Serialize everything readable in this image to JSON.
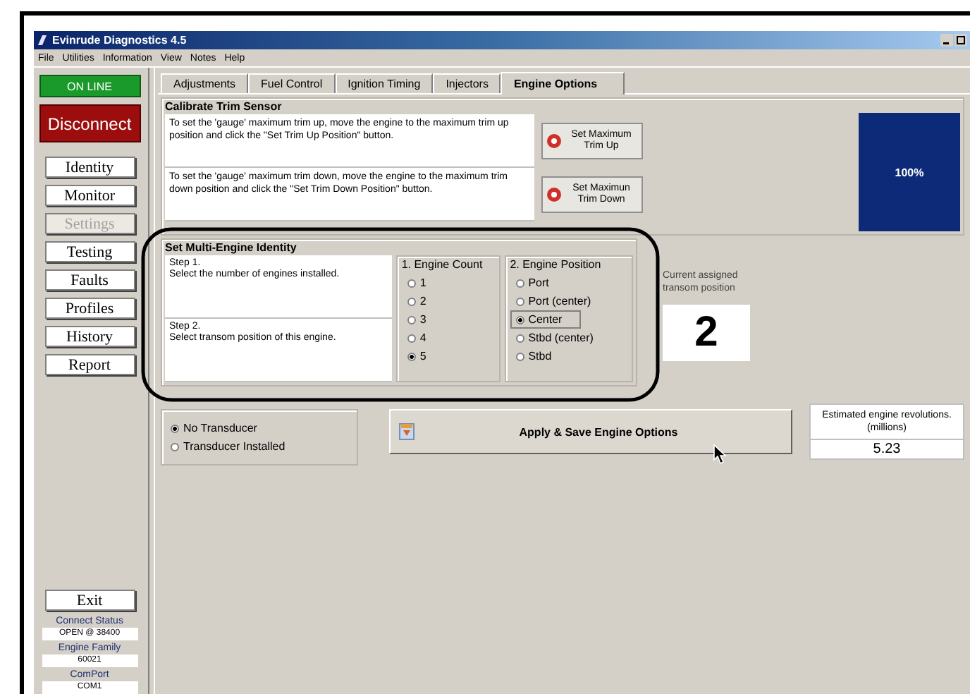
{
  "window": {
    "title": "Evinrude Diagnostics 4.5"
  },
  "menu": [
    "File",
    "Utilities",
    "Information",
    "View",
    "Notes",
    "Help"
  ],
  "sidebar": {
    "status": "ON LINE",
    "disconnect": "Disconnect",
    "items": [
      {
        "label": "Identity",
        "disabled": false
      },
      {
        "label": "Monitor",
        "disabled": false
      },
      {
        "label": "Settings",
        "disabled": true
      },
      {
        "label": "Testing",
        "disabled": false
      },
      {
        "label": "Faults",
        "disabled": false
      },
      {
        "label": "Profiles",
        "disabled": false
      },
      {
        "label": "History",
        "disabled": false
      },
      {
        "label": "Report",
        "disabled": false
      }
    ],
    "exit": "Exit",
    "info": [
      {
        "label": "Connect Status",
        "value": "OPEN @ 38400"
      },
      {
        "label": "Engine Family",
        "value": "60021"
      },
      {
        "label": "ComPort",
        "value": "COM1"
      }
    ]
  },
  "tabs": [
    {
      "label": "Adjustments",
      "selected": false
    },
    {
      "label": "Fuel Control",
      "selected": false
    },
    {
      "label": "Ignition Timing",
      "selected": false
    },
    {
      "label": "Injectors",
      "selected": false
    },
    {
      "label": "Engine Options",
      "selected": true
    }
  ],
  "trim": {
    "title": "Calibrate Trim Sensor",
    "rows": [
      {
        "text": "To set the 'gauge' maximum trim up, move the engine to the maximum trim up position and click the \"Set Trim Up Position\" button.",
        "button": "Set Maximum\nTrim Up"
      },
      {
        "text": "To set the 'gauge' maximum trim down, move the engine to the maximum trim down position and click the \"Set Trim Down Position\" button.",
        "button": "Set Maximun\nTrim Down"
      }
    ],
    "gauge": {
      "level": 1,
      "reading": "100%"
    }
  },
  "identity": {
    "title": "Set Multi-Engine Identity",
    "steps": [
      "Step 1.\nSelect the number of engines installed.",
      "Step 2.\nSelect transom position of this engine."
    ],
    "count": {
      "title": "1. Engine Count",
      "options": [
        {
          "label": "1",
          "selected": false
        },
        {
          "label": "2",
          "selected": false
        },
        {
          "label": "3",
          "selected": false
        },
        {
          "label": "4",
          "selected": false
        },
        {
          "label": "5",
          "selected": true
        }
      ]
    },
    "position": {
      "title": "2. Engine Position",
      "options": [
        {
          "label": "Port",
          "selected": false,
          "focused": false
        },
        {
          "label": "Port (center)",
          "selected": false,
          "focused": false
        },
        {
          "label": "Center",
          "selected": true,
          "focused": true
        },
        {
          "label": "Stbd (center)",
          "selected": false,
          "focused": false
        },
        {
          "label": "Stbd",
          "selected": false,
          "focused": false
        }
      ]
    },
    "current": {
      "label": "Current assigned transom position",
      "value": "2"
    }
  },
  "transducer": {
    "options": [
      {
        "label": "No Transducer",
        "selected": true
      },
      {
        "label": "Transducer Installed",
        "selected": false
      }
    ]
  },
  "apply_button": "Apply & Save Engine Options",
  "revolutions": {
    "label": "Estimated engine revolutions.(millions)",
    "value": "5.23"
  }
}
